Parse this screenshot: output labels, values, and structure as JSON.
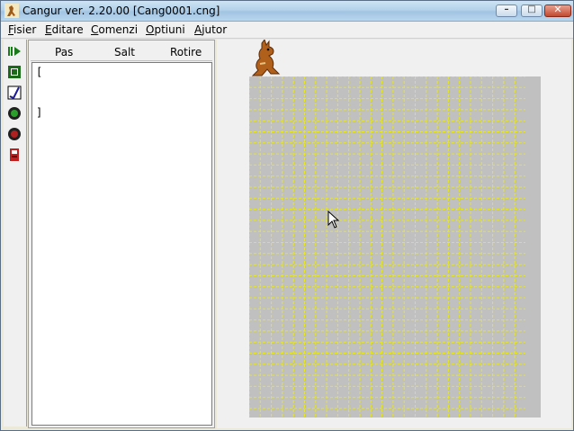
{
  "window": {
    "title": "Cangur ver. 2.20.00  [Cang0001.cng]",
    "minimize_glyph": "–",
    "maximize_glyph": "□",
    "close_glyph": "✕"
  },
  "menu": [
    {
      "first": "F",
      "rest": "isier"
    },
    {
      "first": "E",
      "rest": "ditare"
    },
    {
      "first": "C",
      "rest": "omenzi"
    },
    {
      "first": "O",
      "rest": "ptiuni"
    },
    {
      "first": "A",
      "rest": "jutor"
    }
  ],
  "toolbar_icons": [
    "run-icon",
    "stop-square-icon",
    "edit-check-icon",
    "green-circle-icon",
    "red-circle-icon",
    "exit-door-icon"
  ],
  "columns": {
    "pas": "Pas",
    "salt": "Salt",
    "rotire": "Rotire"
  },
  "editor": {
    "line1": "[",
    "line2": "]"
  },
  "colors": {
    "grid_line": "#e8e81a",
    "board": "#c0c0c0"
  }
}
